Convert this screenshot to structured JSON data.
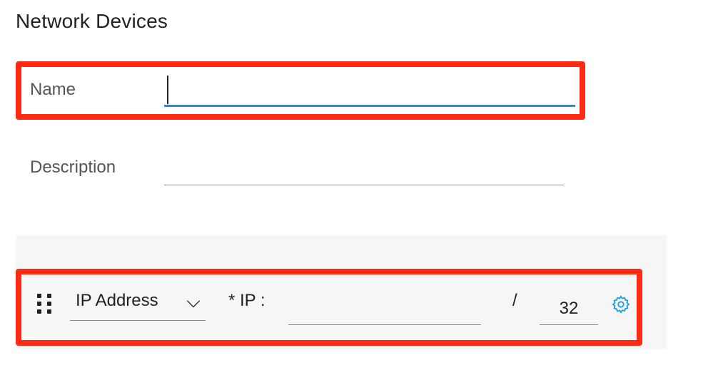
{
  "title": "Network Devices",
  "form": {
    "name": {
      "label": "Name",
      "value": ""
    },
    "description": {
      "label": "Description",
      "value": ""
    }
  },
  "ip_row": {
    "type_label": "IP Address",
    "ip_field_label": "* IP :",
    "ip_value": "",
    "slash": "/",
    "mask_value": "32"
  },
  "colors": {
    "highlight": "#ff2a12",
    "focus_underline": "#1b8fd6",
    "gear": "#1e9fe0"
  }
}
